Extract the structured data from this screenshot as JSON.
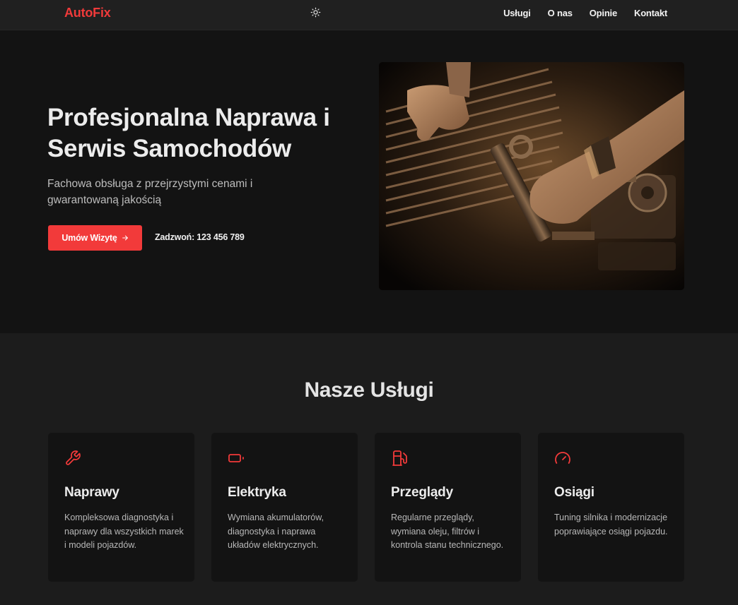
{
  "header": {
    "logo": "AutoFix",
    "theme_icon": "sun-icon",
    "nav": [
      "Usługi",
      "O nas",
      "Opinie",
      "Kontakt"
    ]
  },
  "hero": {
    "title": "Profesjonalna Naprawa i Serwis Samochodów",
    "subtitle": "Fachowa obsługa z przejrzystymi cenami i gwarantowaną jakością",
    "cta_label": "Umów Wizytę",
    "cta_icon": "arrow-right-icon",
    "phone_label": "Zadzwoń: 123 456 789"
  },
  "services": {
    "title": "Nasze Usługi",
    "items": [
      {
        "icon": "wrench-icon",
        "title": "Naprawy",
        "description": "Kompleksowa diagnostyka i naprawy dla wszystkich marek i modeli pojazdów."
      },
      {
        "icon": "battery-icon",
        "title": "Elektryka",
        "description": "Wymiana akumulatorów, diagnostyka i naprawa układów elektrycznych."
      },
      {
        "icon": "fuel-pump-icon",
        "title": "Przeglądy",
        "description": "Regularne przeglądy, wymiana oleju, filtrów i kontrola stanu technicznego."
      },
      {
        "icon": "gauge-icon",
        "title": "Osiągi",
        "description": "Tuning silnika i modernizacje poprawiające osiągi pojazdu."
      }
    ]
  },
  "colors": {
    "accent": "#f23a3a",
    "background": "#1c1c1c",
    "hero_background": "#131313",
    "card_background": "#131313"
  }
}
